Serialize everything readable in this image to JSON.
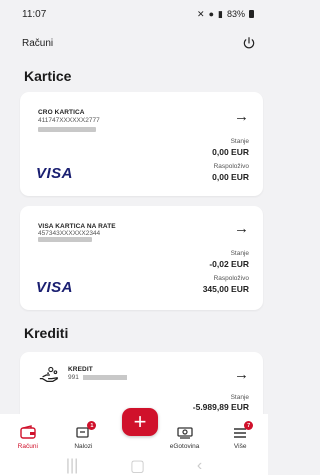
{
  "status_bar": {
    "time": "11:07",
    "battery": "83%"
  },
  "header": {
    "title": "Računi"
  },
  "sections": {
    "cards_title": "Kartice",
    "loans_title": "Krediti"
  },
  "cards": [
    {
      "name": "CRO KARTICA",
      "number": "411747XXXXXX2777",
      "balance_label": "Stanje",
      "balance": "0,00 EUR",
      "available_label": "Raspoloživo",
      "available": "0,00 EUR",
      "brand": "VISA"
    },
    {
      "name": "VISA KARTICA NA RATE",
      "number": "457343XXXXXX2344",
      "balance_label": "Stanje",
      "balance": "-0,02 EUR",
      "available_label": "Raspoloživo",
      "available": "345,00 EUR",
      "brand": "VISA"
    }
  ],
  "loan": {
    "name": "KREDIT",
    "number_prefix": "991",
    "balance_label": "Stanje",
    "balance": "-5.989,89 EUR"
  },
  "nav": {
    "accounts": "Računi",
    "orders": "Nalozi",
    "orders_badge": "1",
    "cash": "eGotovina",
    "more": "Više",
    "more_badge": "7",
    "fab": "+"
  },
  "colors": {
    "accent": "#d0112b",
    "visa_blue": "#1a1f71"
  }
}
